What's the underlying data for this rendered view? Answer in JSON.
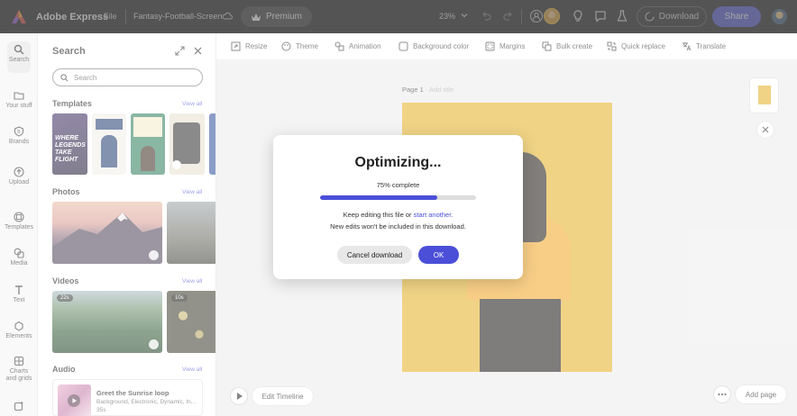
{
  "topbar": {
    "app_name": "Adobe Express",
    "file_menu": "File",
    "document_name": "Fantasy-Football-Screen",
    "premium_label": "Premium",
    "zoom_level": "23%",
    "download_label": "Download",
    "share_label": "Share",
    "accent_color": "#4b4fd8"
  },
  "rail": {
    "items": [
      {
        "label": "Search",
        "icon": "search-icon"
      },
      {
        "label": "Your stuff",
        "icon": "folder-icon"
      },
      {
        "label": "Brands",
        "icon": "brand-icon"
      },
      {
        "label": "Upload",
        "icon": "upload-icon"
      },
      {
        "label": "Templates",
        "icon": "templates-icon"
      },
      {
        "label": "Media",
        "icon": "media-icon"
      },
      {
        "label": "Text",
        "icon": "text-icon"
      },
      {
        "label": "Elements",
        "icon": "elements-icon"
      },
      {
        "label": "Charts and grids",
        "icon": "chart-icon"
      },
      {
        "label": "",
        "icon": "add-ons-icon"
      }
    ]
  },
  "panel": {
    "title": "Search",
    "search_placeholder": "Search",
    "templates_title": "Templates",
    "photos_title": "Photos",
    "videos_title": "Videos",
    "audio_title": "Audio",
    "view_all": "View all",
    "template1_text": "WHERE LEGENDS TAKE FLIGHT",
    "video1_duration": "22s",
    "video2_duration": "10s",
    "audio_item": {
      "title": "Greet the Sunrise loop",
      "tags": "Background, Electronic, Dynamic, In...",
      "duration": "35s"
    }
  },
  "toolbar": {
    "tools": [
      {
        "label": "Resize",
        "icon": "resize-icon"
      },
      {
        "label": "Theme",
        "icon": "theme-icon"
      },
      {
        "label": "Animation",
        "icon": "animation-icon"
      },
      {
        "label": "Background color",
        "icon": "background-color-icon"
      },
      {
        "label": "Margins",
        "icon": "margins-icon"
      },
      {
        "label": "Bulk create",
        "icon": "bulk-create-icon"
      },
      {
        "label": "Quick replace",
        "icon": "quick-replace-icon"
      },
      {
        "label": "Translate",
        "icon": "translate-icon"
      }
    ]
  },
  "canvas": {
    "page_label": "Page 1",
    "add_title": "Add title",
    "edit_timeline": "Edit Timeline",
    "add_page": "Add page",
    "background_color": "#e3b021"
  },
  "modal": {
    "title": "Optimizing...",
    "progress_text": "75% complete",
    "progress_value": 0.75,
    "line1_prefix": "Keep editing this file or ",
    "line1_link": "start another.",
    "line2": "New edits won't be included in this download.",
    "cancel_label": "Cancel download",
    "ok_label": "OK"
  }
}
